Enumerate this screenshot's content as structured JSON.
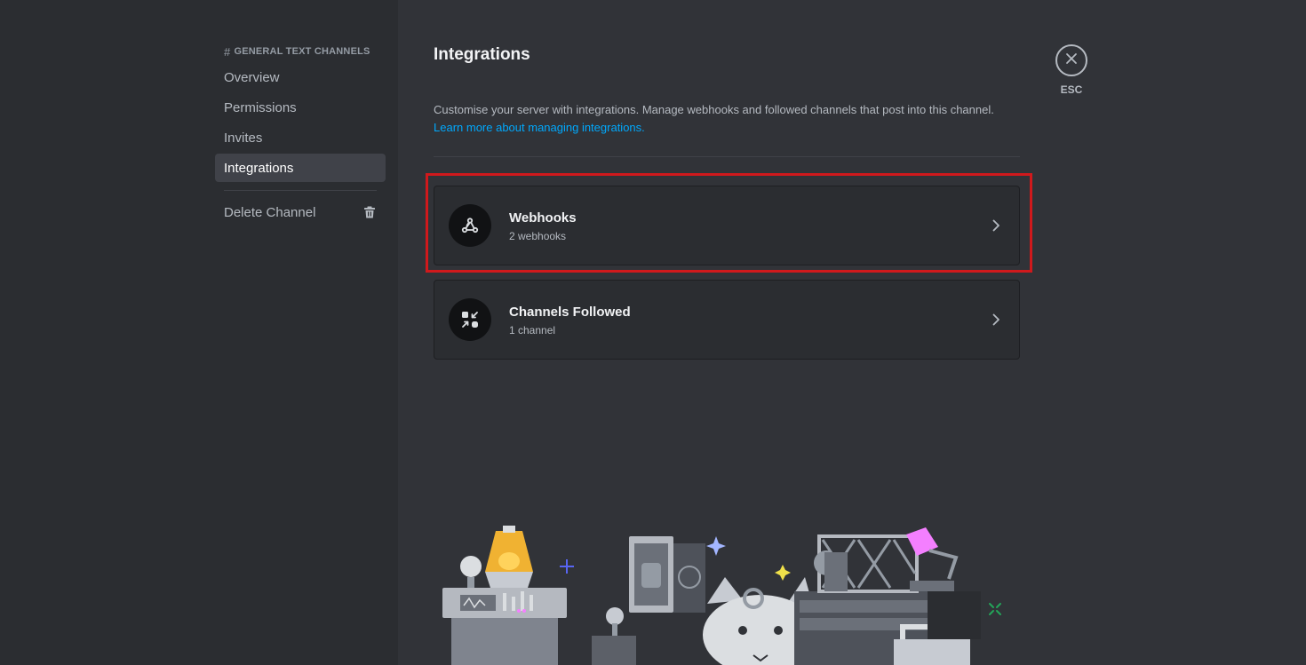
{
  "sidebar": {
    "section_header": {
      "hash": "#",
      "label": "GENERAL  TEXT CHANNELS"
    },
    "items": [
      {
        "label": "Overview"
      },
      {
        "label": "Permissions"
      },
      {
        "label": "Invites"
      },
      {
        "label": "Integrations",
        "selected": true
      }
    ],
    "delete_label": "Delete Channel"
  },
  "main": {
    "title": "Integrations",
    "description": "Customise your server with integrations. Manage webhooks and followed channels that post into this channel.",
    "learn_more": "Learn more about managing integrations.",
    "cards": [
      {
        "title": "Webhooks",
        "subtitle": "2 webhooks",
        "icon": "webhook-icon",
        "highlighted": true
      },
      {
        "title": "Channels Followed",
        "subtitle": "1 channel",
        "icon": "channels-followed-icon"
      }
    ]
  },
  "close": {
    "label": "ESC"
  },
  "colors": {
    "sidebar_bg": "#2b2d31",
    "main_bg": "#313338",
    "selected_bg": "#404249",
    "link": "#00a8fc",
    "highlight": "#d0191c"
  }
}
